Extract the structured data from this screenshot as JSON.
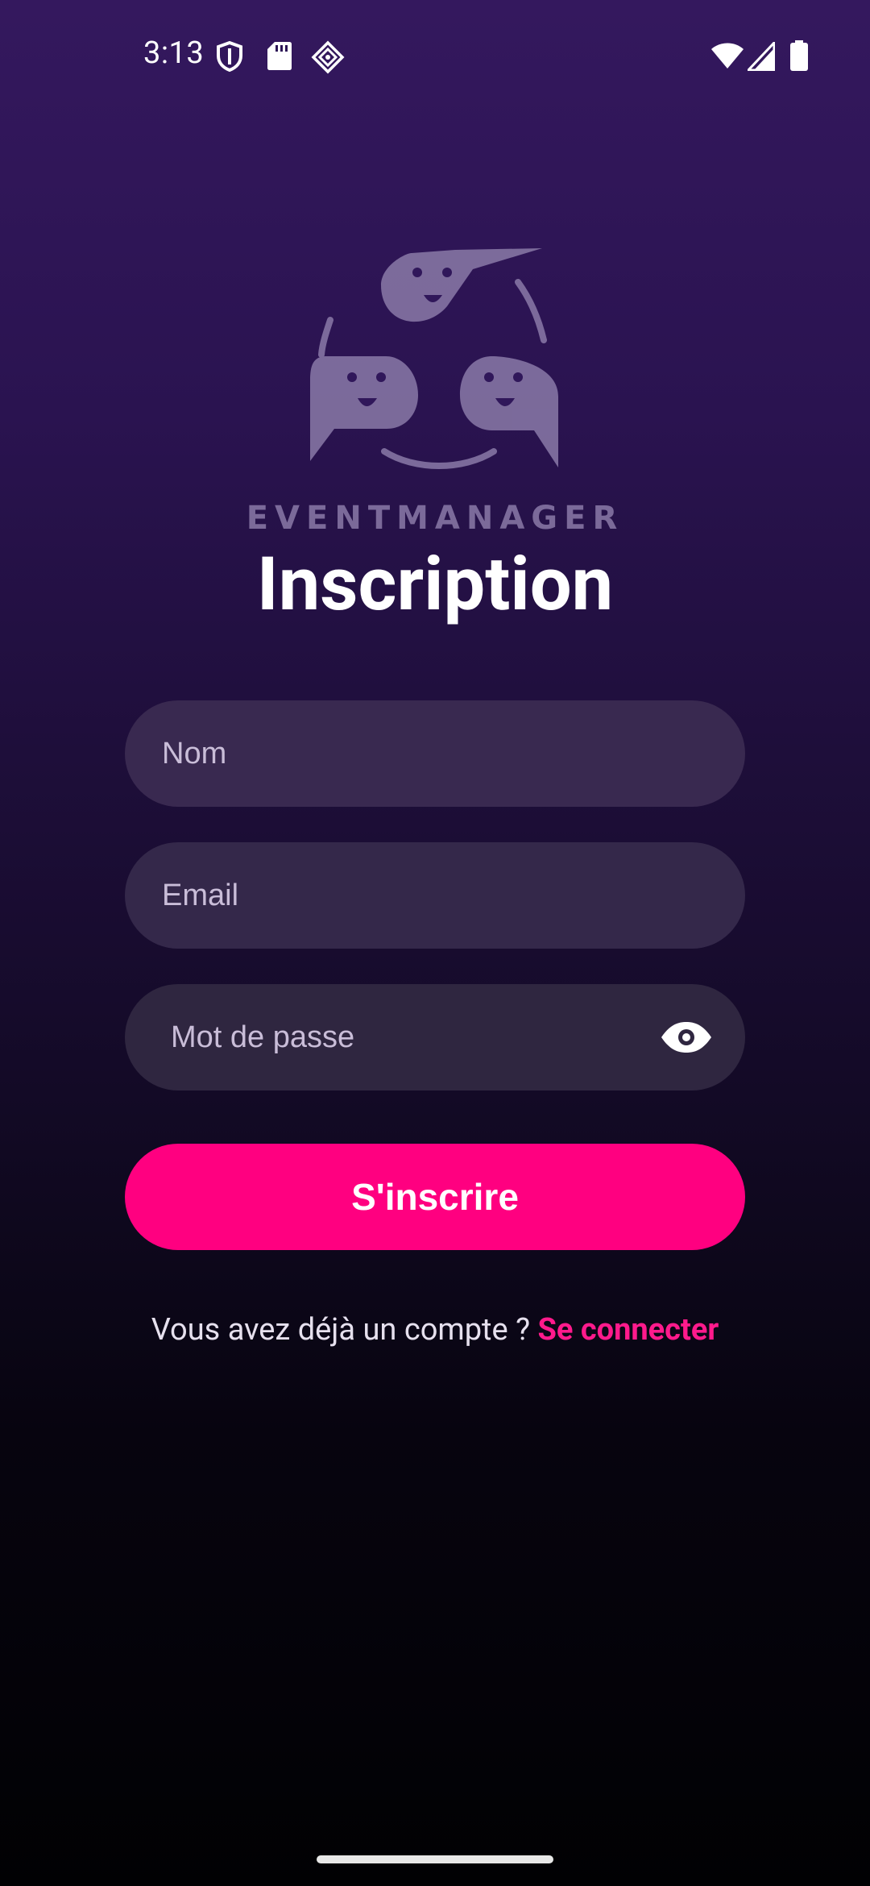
{
  "status_bar": {
    "time": "3:13",
    "left_icons": [
      "shield-icon",
      "sd-card-icon",
      "vpn-diamond-icon"
    ],
    "right_icons": [
      "wifi-icon",
      "signal-icon",
      "battery-icon"
    ]
  },
  "logo": {
    "text": "EVENTMANAGER",
    "icon": "chat-faces-logo"
  },
  "title": "Inscription",
  "form": {
    "name_placeholder": "Nom",
    "email_placeholder": "Email",
    "password_placeholder": "Mot de passe",
    "password_toggle_icon": "eye-icon",
    "submit_label": "S'inscrire"
  },
  "footer": {
    "prompt": "Vous avez déjà un compte ? ",
    "link": "Se connecter"
  },
  "colors": {
    "accent": "#ff0080",
    "link": "#ff1a8c",
    "background_top": "#34185e",
    "background_bottom": "#010103"
  }
}
